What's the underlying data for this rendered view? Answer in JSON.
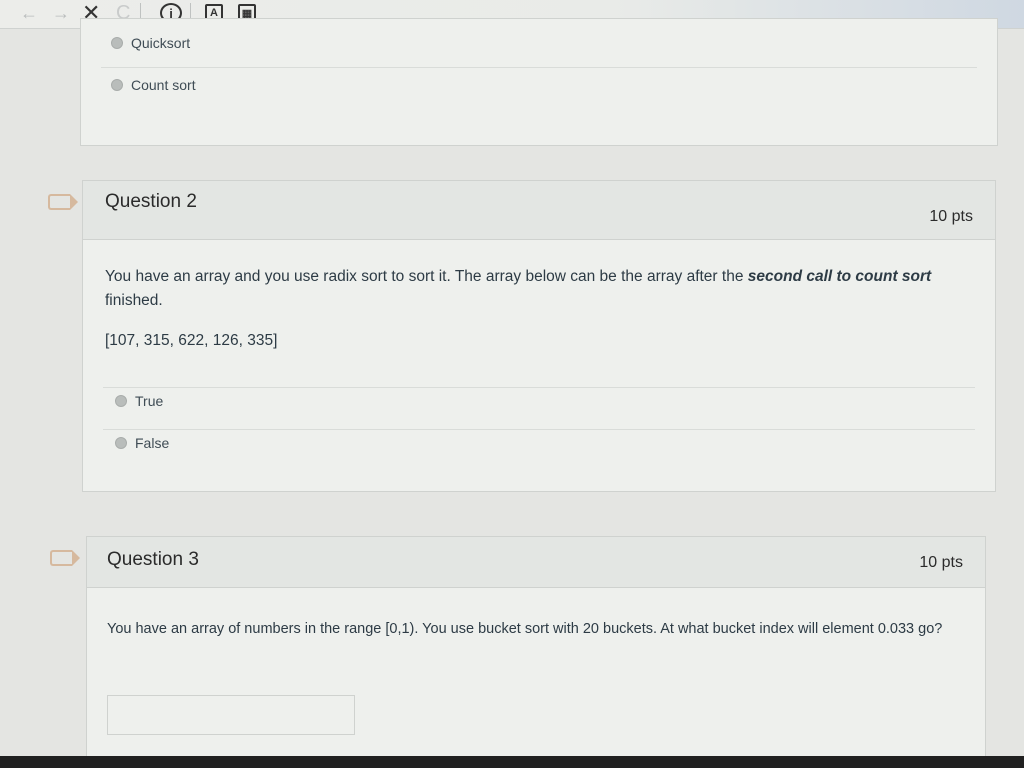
{
  "toolbar": {
    "back_icon": "←",
    "forward_icon": "→",
    "close_icon": "✕",
    "reload_icon": "C",
    "info_icon": "i",
    "reader_icon": "A",
    "calc_icon": "▦"
  },
  "question1": {
    "options": [
      {
        "label": "Quicksort"
      },
      {
        "label": "Count sort"
      }
    ]
  },
  "question2": {
    "title": "Question 2",
    "points": "10 pts",
    "text_part1": "You have an array and you use radix sort to sort it. The array below can be the array after the ",
    "text_emphasis": "second call to count sort",
    "text_part2": " finished.",
    "array": "[107, 315, 622, 126, 335]",
    "options": [
      {
        "label": "True"
      },
      {
        "label": "False"
      }
    ]
  },
  "question3": {
    "title": "Question 3",
    "points": "10 pts",
    "text": "You have an array of numbers in the range [0,1). You use bucket sort with 20 buckets. At what bucket index will element 0.033 go?",
    "answer_value": ""
  }
}
